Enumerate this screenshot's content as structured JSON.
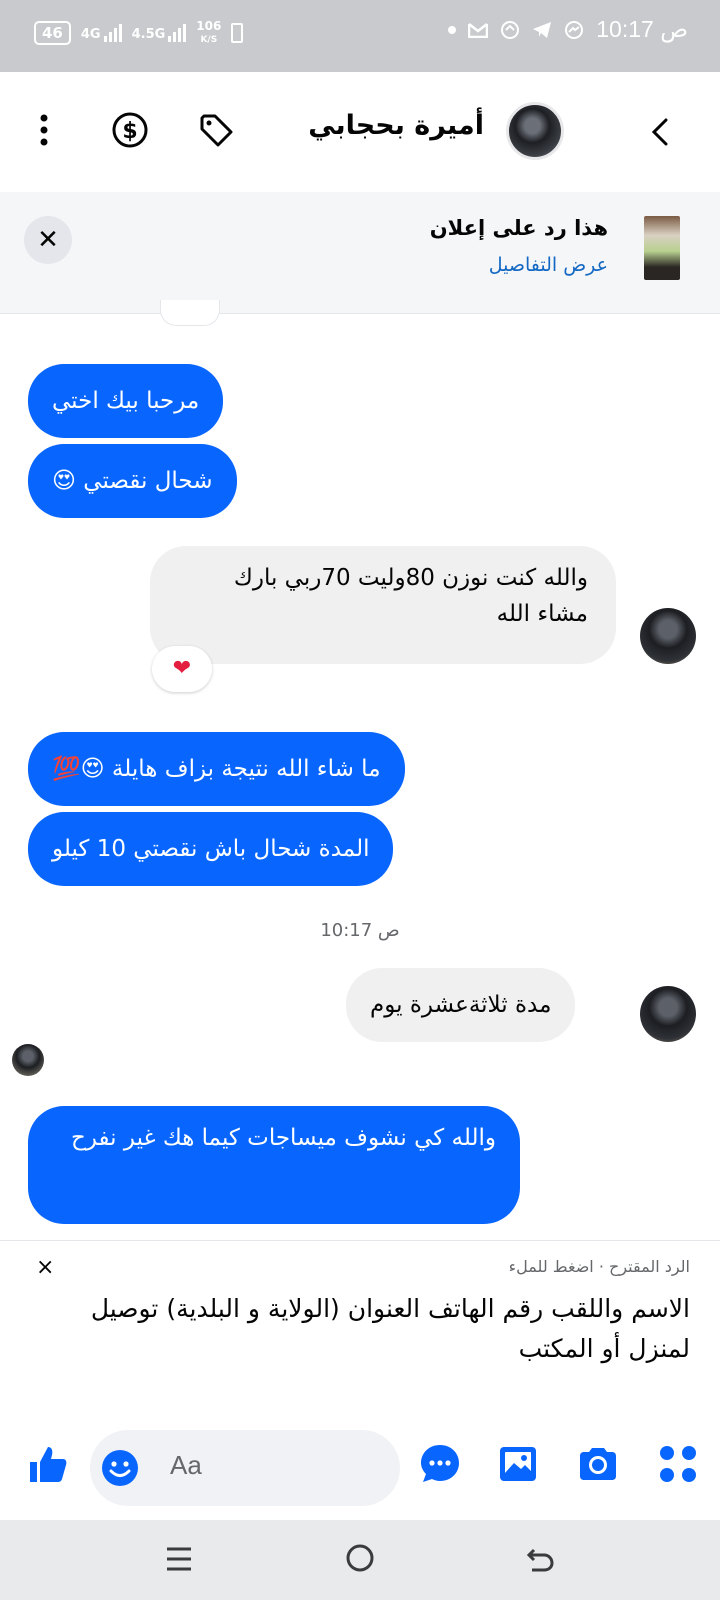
{
  "status_bar": {
    "battery": "46",
    "net1": "4G",
    "net2": "4.5G",
    "speed_value": "106",
    "speed_unit": "K/S",
    "time": "10:17 ص"
  },
  "header": {
    "contact_name": "أميرة بحجابي"
  },
  "ad_banner": {
    "title": "هذا رد على إعلان",
    "link": "عرض التفاصيل",
    "close": "✕"
  },
  "messages": [
    {
      "side": "out",
      "text": "مرحبا بيك اختي"
    },
    {
      "side": "out",
      "text": "شحال نقصتي 😍"
    },
    {
      "side": "in",
      "text": "والله كنت نوزن 80وليت 70ربي بارك مشاء الله",
      "reaction": "❤"
    },
    {
      "side": "out",
      "text": "ما شاء الله نتيجة بزاف هايلة 😍💯"
    },
    {
      "side": "out",
      "text": "المدة شحال باش نقصتي 10 كيلو"
    },
    {
      "side": "in",
      "text": "مدة ثلاثةعشرة يوم"
    },
    {
      "side": "out",
      "text": "والله كي نشوف ميساجات كيما هك غير نفرح"
    }
  ],
  "timestamp": "10:17 ص",
  "suggested_reply": {
    "label": "الرد المقترح · اضغط للملء",
    "text": "الاسم واللقب رقم الهاتف العنوان (الولاية و البلدية) توصيل لمنزل أو المكتب",
    "close": "×"
  },
  "composer": {
    "placeholder": "Aa"
  },
  "colors": {
    "accent": "#0866ff",
    "incoming_bubble": "#f0f0f0",
    "link": "#1368c4"
  },
  "icons": [
    "back-icon",
    "dollar-icon",
    "tag-icon",
    "more-icon",
    "like-icon",
    "emoji-icon",
    "chat-icon",
    "gallery-icon",
    "camera-icon",
    "apps-icon",
    "menu-icon",
    "home-icon",
    "return-icon"
  ]
}
